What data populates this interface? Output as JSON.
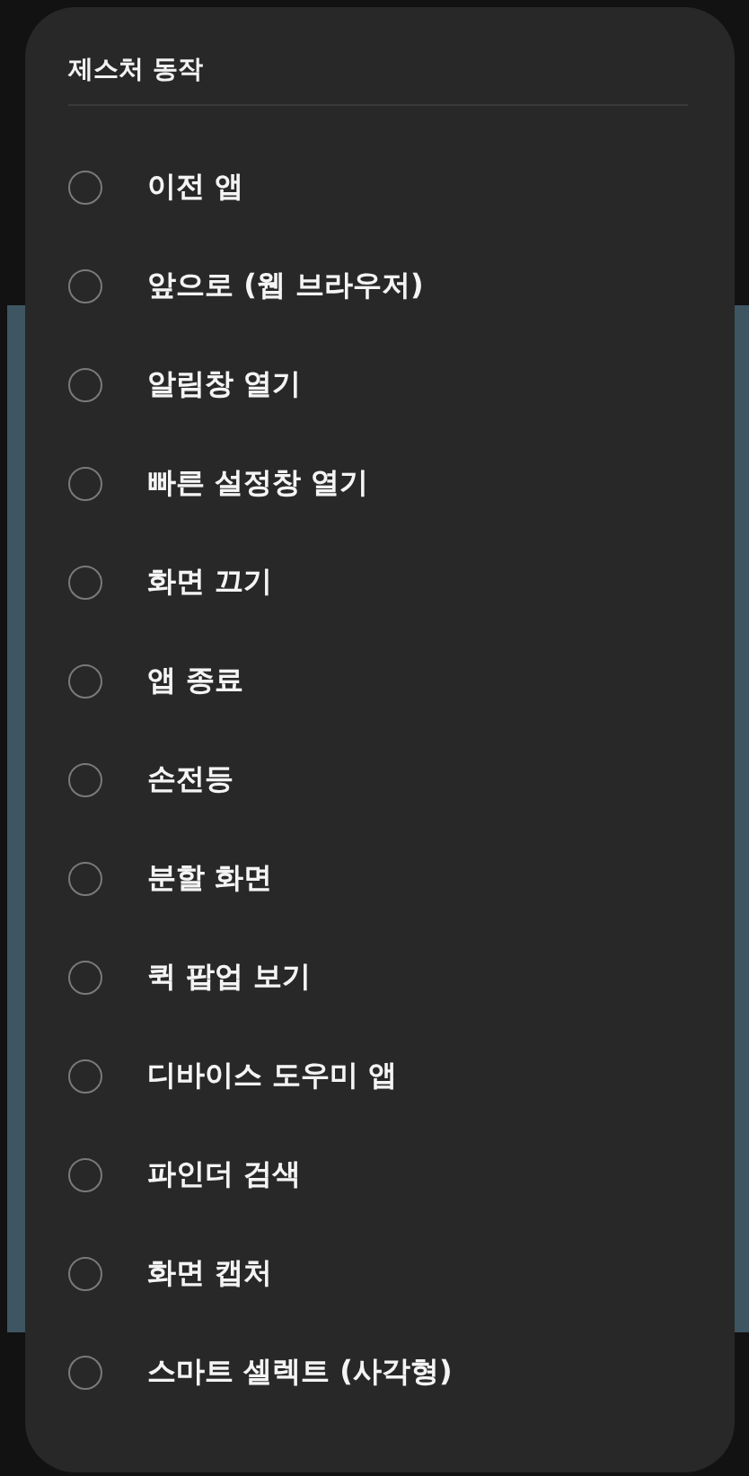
{
  "dialog": {
    "title": "제스처 동작",
    "options": [
      {
        "label": "이전 앱",
        "selected": false
      },
      {
        "label": "앞으로 (웹 브라우저)",
        "selected": false
      },
      {
        "label": "알림창 열기",
        "selected": false
      },
      {
        "label": "빠른 설정창 열기",
        "selected": false
      },
      {
        "label": "화면 끄기",
        "selected": false
      },
      {
        "label": "앱 종료",
        "selected": false
      },
      {
        "label": "손전등",
        "selected": false
      },
      {
        "label": "분할 화면",
        "selected": false
      },
      {
        "label": "퀵 팝업 보기",
        "selected": false
      },
      {
        "label": "디바이스 도우미 앱",
        "selected": false
      },
      {
        "label": "파인더 검색",
        "selected": false
      },
      {
        "label": "화면 캡처",
        "selected": false
      },
      {
        "label": "스마트 셀렉트 (사각형)",
        "selected": false
      }
    ]
  }
}
